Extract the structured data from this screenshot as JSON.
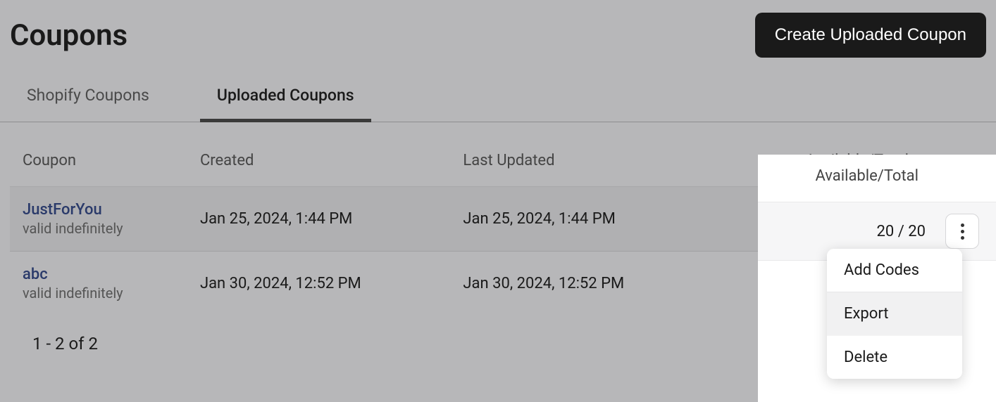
{
  "header": {
    "title": "Coupons",
    "create_button": "Create Uploaded Coupon"
  },
  "tabs": [
    {
      "label": "Shopify Coupons",
      "active": false
    },
    {
      "label": "Uploaded Coupons",
      "active": true
    }
  ],
  "table": {
    "columns": {
      "coupon": "Coupon",
      "created": "Created",
      "updated": "Last Updated",
      "available": "Available/Total"
    },
    "rows": [
      {
        "name": "JustForYou",
        "validity": "valid indefinitely",
        "created": "Jan 25, 2024, 1:44 PM",
        "updated": "Jan 25, 2024, 1:44 PM",
        "available_total": "20 / 20"
      },
      {
        "name": "abc",
        "validity": "valid indefinitely",
        "created": "Jan 30, 2024, 12:52 PM",
        "updated": "Jan 30, 2024, 12:52 PM",
        "available_total": ""
      }
    ]
  },
  "pagination": "1 - 2 of 2",
  "dropdown": {
    "items": [
      {
        "label": "Add Codes"
      },
      {
        "label": "Export",
        "hover": true
      },
      {
        "label": "Delete"
      }
    ]
  }
}
